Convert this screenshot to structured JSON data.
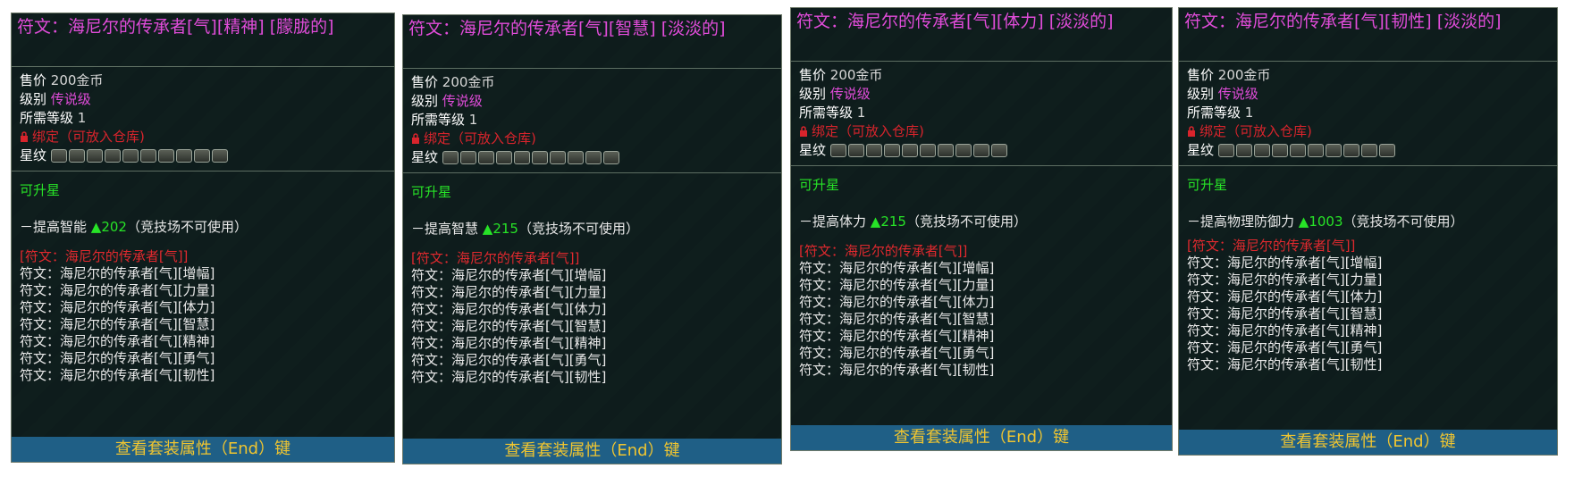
{
  "tooltips": [
    {
      "title": "符文：海尼尔的传承者[气][精神] [朦胧的]",
      "price_label": "售价",
      "price_value": "200金币",
      "grade_label": "级别",
      "grade_value": "传说级",
      "level_label": "所需等级",
      "level_value": "1",
      "bind_text": "绑定（可放入仓库)",
      "star_label": "星纹",
      "upgrade_text": "可升星",
      "stat_prefix": "－提高智能",
      "stat_value": "▲202",
      "stat_suffix": "（竞技场不可使用）",
      "set_header": "[符文：海尼尔的传承者[气]]",
      "set_items": [
        "符文：海尼尔的传承者[气][增幅]",
        "符文：海尼尔的传承者[气][力量]",
        "符文：海尼尔的传承者[气][体力]",
        "符文：海尼尔的传承者[气][智慧]",
        "符文：海尼尔的传承者[气][精神]",
        "符文：海尼尔的传承者[气][勇气]",
        "符文：海尼尔的传承者[气][韧性]"
      ],
      "footer": "查看套装属性（End）键"
    },
    {
      "title": "符文：海尼尔的传承者[气][智慧] [淡淡的]",
      "price_label": "售价",
      "price_value": "200金币",
      "grade_label": "级别",
      "grade_value": "传说级",
      "level_label": "所需等级",
      "level_value": "1",
      "bind_text": "绑定（可放入仓库)",
      "star_label": "星纹",
      "upgrade_text": "可升星",
      "stat_prefix": "－提高智慧",
      "stat_value": "▲215",
      "stat_suffix": "（竞技场不可使用）",
      "set_header": "[符文：海尼尔的传承者[气]]",
      "set_items": [
        "符文：海尼尔的传承者[气][增幅]",
        "符文：海尼尔的传承者[气][力量]",
        "符文：海尼尔的传承者[气][体力]",
        "符文：海尼尔的传承者[气][智慧]",
        "符文：海尼尔的传承者[气][精神]",
        "符文：海尼尔的传承者[气][勇气]",
        "符文：海尼尔的传承者[气][韧性]"
      ],
      "footer": "查看套装属性（End）键"
    },
    {
      "title": "符文：海尼尔的传承者[气][体力] [淡淡的]",
      "price_label": "售价",
      "price_value": "200金币",
      "grade_label": "级别",
      "grade_value": "传说级",
      "level_label": "所需等级",
      "level_value": "1",
      "bind_text": "绑定（可放入仓库)",
      "star_label": "星纹",
      "upgrade_text": "可升星",
      "stat_prefix": "－提高体力",
      "stat_value": "▲215",
      "stat_suffix": "（竞技场不可使用）",
      "set_header": "[符文：海尼尔的传承者[气]]",
      "set_items": [
        "符文：海尼尔的传承者[气][增幅]",
        "符文：海尼尔的传承者[气][力量]",
        "符文：海尼尔的传承者[气][体力]",
        "符文：海尼尔的传承者[气][智慧]",
        "符文：海尼尔的传承者[气][精神]",
        "符文：海尼尔的传承者[气][勇气]",
        "符文：海尼尔的传承者[气][韧性]"
      ],
      "footer": "查看套装属性（End）键"
    },
    {
      "title": "符文：海尼尔的传承者[气][韧性] [淡淡的]",
      "price_label": "售价",
      "price_value": "200金币",
      "grade_label": "级别",
      "grade_value": "传说级",
      "level_label": "所需等级",
      "level_value": "1",
      "bind_text": "绑定（可放入仓库)",
      "star_label": "星纹",
      "upgrade_text": "可升星",
      "stat_prefix": "－提高物理防御力",
      "stat_value": "▲1003",
      "stat_suffix": "（竞技场不可使用）",
      "set_header": "[符文：海尼尔的传承者[气]]",
      "set_items": [
        "符文：海尼尔的传承者[气][增幅]",
        "符文：海尼尔的传承者[气][力量]",
        "符文：海尼尔的传承者[气][体力]",
        "符文：海尼尔的传承者[气][智慧]",
        "符文：海尼尔的传承者[气][精神]",
        "符文：海尼尔的传承者[气][勇气]",
        "符文：海尼尔的传承者[气][韧性]"
      ],
      "footer": "查看套装属性（End）键"
    }
  ],
  "colors": {
    "title": "#e04cd9",
    "bind": "#d8242c",
    "upgrade": "#27e327",
    "set_header": "#e0292e",
    "footer_text": "#f0c530",
    "footer_bg": "#1f5f86"
  },
  "icons": {
    "lock": "lock-icon",
    "star_slot": "star-slot-icon"
  }
}
